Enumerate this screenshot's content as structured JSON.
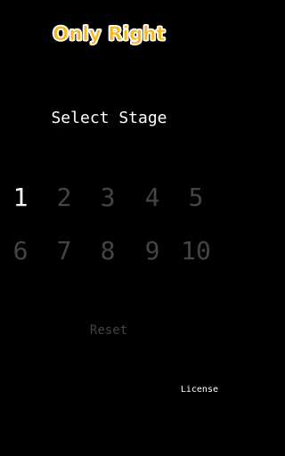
{
  "app": {
    "title": "Only Right",
    "subtitle": "Select Stage"
  },
  "stages": [
    {
      "label": "1",
      "state": "unlocked"
    },
    {
      "label": "2",
      "state": "locked"
    },
    {
      "label": "3",
      "state": "locked"
    },
    {
      "label": "4",
      "state": "locked"
    },
    {
      "label": "5",
      "state": "locked"
    },
    {
      "label": "6",
      "state": "locked"
    },
    {
      "label": "7",
      "state": "locked"
    },
    {
      "label": "8",
      "state": "locked"
    },
    {
      "label": "9",
      "state": "locked"
    },
    {
      "label": "10",
      "state": "locked"
    }
  ],
  "controls": {
    "reset_label": "Reset",
    "license_label": "License"
  },
  "colors": {
    "background": "#000000",
    "logo_fill": "#f6b820",
    "logo_outline": "#ffffff",
    "active_text": "#ffffff",
    "locked_text": "#444444"
  }
}
